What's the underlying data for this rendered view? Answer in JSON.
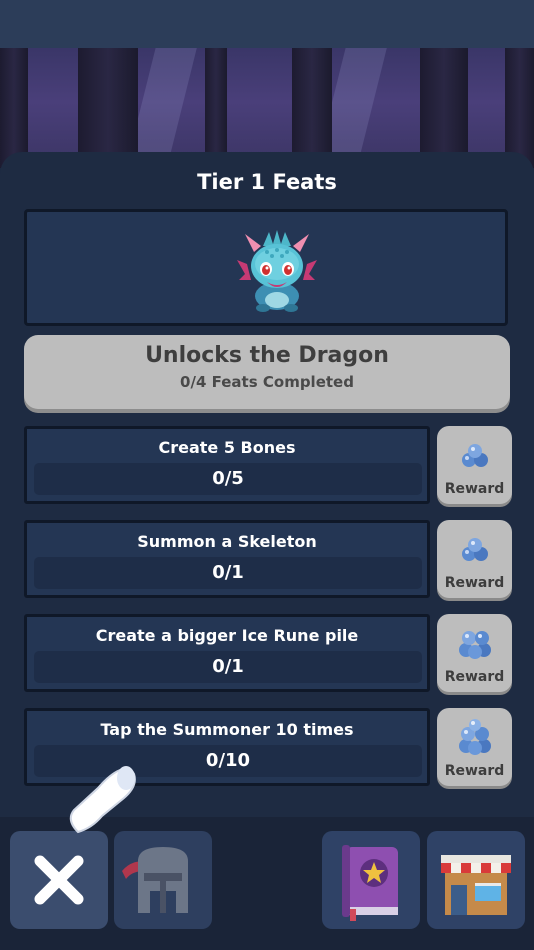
{
  "panel": {
    "title": "Tier 1 Feats",
    "portrait": {
      "icon": "dragon-icon"
    },
    "unlock": {
      "title": "Unlocks the Dragon",
      "subtitle": "0/4 Feats Completed",
      "completed": 0,
      "total": 4
    },
    "feats": [
      {
        "label": "Create 5 Bones",
        "progress": "0/5",
        "reward_label": "Reward",
        "reward_icon": "rune-stones-icon"
      },
      {
        "label": "Summon a Skeleton",
        "progress": "0/1",
        "reward_label": "Reward",
        "reward_icon": "rune-stones-icon"
      },
      {
        "label": "Create a bigger Ice Rune pile",
        "progress": "0/1",
        "reward_label": "Reward",
        "reward_icon": "rune-stones-icon"
      },
      {
        "label": "Tap the Summoner 10 times",
        "progress": "0/10",
        "reward_label": "Reward",
        "reward_icon": "rune-stones-icon"
      }
    ]
  },
  "bottom_nav": {
    "items": [
      {
        "icon": "close-icon"
      },
      {
        "icon": "helmet-icon"
      },
      {
        "icon": "spellbook-icon"
      },
      {
        "icon": "shop-icon"
      }
    ]
  },
  "colors": {
    "panel_bg": "#1e2b42",
    "button_gray": "#bdbdbd",
    "text_dark": "#3e3e3e",
    "text_light": "#ffffff"
  }
}
